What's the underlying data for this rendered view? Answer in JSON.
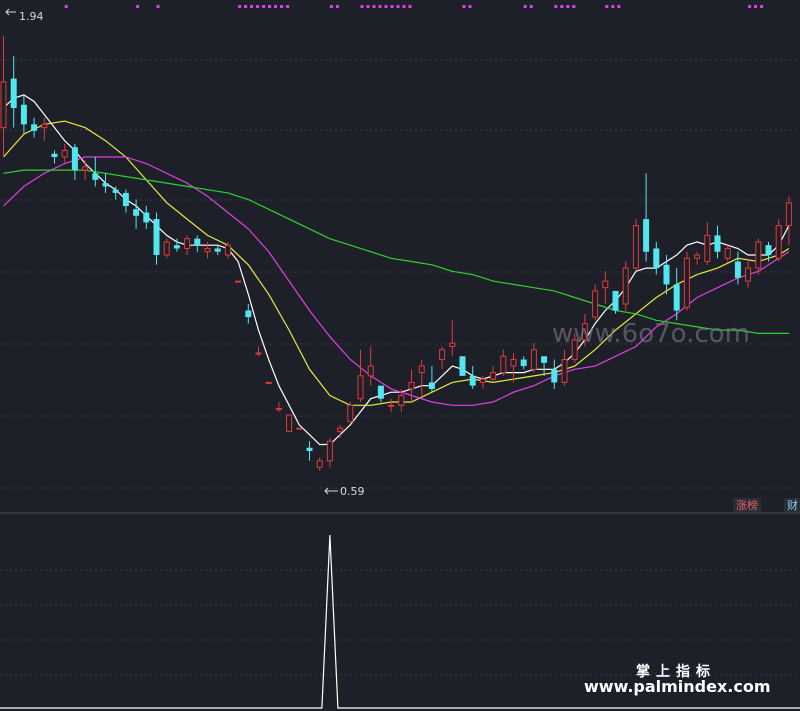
{
  "chart_data": {
    "type": "candlestick",
    "price_range": [
      0.5,
      2.0
    ],
    "high_label": "1.94",
    "low_label": "0.59",
    "tags": {
      "limit_up": "涨榜",
      "finance": "财"
    },
    "colors": {
      "background": "#1e2029",
      "up": "#e03a3a",
      "down": "#52e6f0",
      "ma_white": "#ffffff",
      "ma_yellow": "#e8e840",
      "ma_magenta": "#e040e0",
      "ma_green": "#30d030",
      "marker": "#e040e0"
    },
    "candles": [
      [
        1.64,
        1.92,
        1.55,
        1.78
      ],
      [
        1.79,
        1.86,
        1.64,
        1.7
      ],
      [
        1.71,
        1.74,
        1.62,
        1.65
      ],
      [
        1.65,
        1.67,
        1.61,
        1.63
      ],
      [
        1.64,
        1.67,
        1.6,
        1.65
      ],
      [
        1.56,
        1.57,
        1.53,
        1.55
      ],
      [
        1.55,
        1.59,
        1.53,
        1.57
      ],
      [
        1.58,
        1.59,
        1.48,
        1.51
      ],
      [
        1.51,
        1.54,
        1.48,
        1.52
      ],
      [
        1.5,
        1.55,
        1.46,
        1.48
      ],
      [
        1.47,
        1.5,
        1.44,
        1.46
      ],
      [
        1.45,
        1.46,
        1.42,
        1.44
      ],
      [
        1.44,
        1.45,
        1.38,
        1.4
      ],
      [
        1.39,
        1.42,
        1.33,
        1.37
      ],
      [
        1.38,
        1.4,
        1.33,
        1.35
      ],
      [
        1.36,
        1.38,
        1.22,
        1.25
      ],
      [
        1.25,
        1.3,
        1.24,
        1.29
      ],
      [
        1.28,
        1.3,
        1.26,
        1.27
      ],
      [
        1.27,
        1.31,
        1.25,
        1.3
      ],
      [
        1.3,
        1.31,
        1.26,
        1.28
      ],
      [
        1.26,
        1.29,
        1.24,
        1.27
      ],
      [
        1.27,
        1.28,
        1.25,
        1.26
      ],
      [
        1.25,
        1.29,
        1.24,
        1.28
      ],
      [
        1.17,
        1.17,
        1.17,
        1.17
      ],
      [
        1.08,
        1.1,
        1.04,
        1.06
      ],
      [
        0.95,
        0.97,
        0.94,
        0.95
      ],
      [
        0.86,
        0.86,
        0.86,
        0.86
      ],
      [
        0.78,
        0.8,
        0.77,
        0.78
      ],
      [
        0.71,
        0.76,
        0.71,
        0.76
      ],
      [
        0.72,
        0.72,
        0.72,
        0.72
      ],
      [
        0.66,
        0.68,
        0.62,
        0.65
      ],
      [
        0.6,
        0.63,
        0.59,
        0.62
      ],
      [
        0.62,
        0.69,
        0.6,
        0.68
      ],
      [
        0.71,
        0.73,
        0.69,
        0.72
      ],
      [
        0.74,
        0.8,
        0.74,
        0.79
      ],
      [
        0.81,
        0.96,
        0.8,
        0.88
      ],
      [
        0.88,
        0.97,
        0.85,
        0.91
      ],
      [
        0.85,
        0.85,
        0.8,
        0.81
      ],
      [
        0.79,
        0.81,
        0.77,
        0.79
      ],
      [
        0.79,
        0.84,
        0.77,
        0.82
      ],
      [
        0.84,
        0.9,
        0.8,
        0.86
      ],
      [
        0.89,
        0.93,
        0.82,
        0.91
      ],
      [
        0.86,
        0.91,
        0.83,
        0.84
      ],
      [
        0.93,
        0.97,
        0.9,
        0.96
      ],
      [
        0.97,
        1.05,
        0.94,
        0.98
      ],
      [
        0.94,
        0.94,
        0.88,
        0.88
      ],
      [
        0.88,
        0.91,
        0.84,
        0.85
      ],
      [
        0.86,
        0.88,
        0.84,
        0.87
      ],
      [
        0.87,
        0.91,
        0.86,
        0.89
      ],
      [
        0.89,
        0.96,
        0.88,
        0.94
      ],
      [
        0.91,
        0.95,
        0.86,
        0.93
      ],
      [
        0.93,
        0.94,
        0.9,
        0.91
      ],
      [
        0.9,
        0.98,
        0.89,
        0.96
      ],
      [
        0.94,
        0.94,
        0.88,
        0.92
      ],
      [
        0.9,
        0.93,
        0.84,
        0.86
      ],
      [
        0.86,
        0.96,
        0.85,
        0.93
      ],
      [
        0.93,
        1.01,
        0.92,
        0.99
      ],
      [
        0.99,
        1.07,
        0.97,
        1.04
      ],
      [
        1.06,
        1.16,
        1.05,
        1.14
      ],
      [
        1.15,
        1.2,
        1.1,
        1.17
      ],
      [
        1.14,
        1.14,
        1.07,
        1.08
      ],
      [
        1.1,
        1.23,
        1.08,
        1.21
      ],
      [
        1.21,
        1.36,
        1.2,
        1.34
      ],
      [
        1.36,
        1.5,
        1.23,
        1.26
      ],
      [
        1.27,
        1.29,
        1.19,
        1.21
      ],
      [
        1.22,
        1.25,
        1.13,
        1.16
      ],
      [
        1.16,
        1.21,
        1.05,
        1.08
      ],
      [
        1.09,
        1.26,
        1.08,
        1.24
      ],
      [
        1.24,
        1.26,
        1.22,
        1.25
      ],
      [
        1.23,
        1.35,
        1.22,
        1.31
      ],
      [
        1.31,
        1.34,
        1.24,
        1.26
      ],
      [
        1.24,
        1.28,
        1.23,
        1.27
      ],
      [
        1.23,
        1.26,
        1.16,
        1.18
      ],
      [
        1.17,
        1.24,
        1.15,
        1.21
      ],
      [
        1.21,
        1.3,
        1.19,
        1.29
      ],
      [
        1.28,
        1.29,
        1.23,
        1.25
      ],
      [
        1.24,
        1.36,
        1.23,
        1.34
      ],
      [
        1.34,
        1.43,
        1.28,
        1.41
      ]
    ],
    "moving_averages": [
      {
        "color": "#ffffff",
        "points": [
          [
            0,
            1.7
          ],
          [
            1,
            1.73
          ],
          [
            2,
            1.74
          ],
          [
            3,
            1.72
          ],
          [
            4,
            1.68
          ],
          [
            5,
            1.64
          ],
          [
            6,
            1.6
          ],
          [
            7,
            1.57
          ],
          [
            8,
            1.53
          ],
          [
            9,
            1.5
          ],
          [
            10,
            1.47
          ],
          [
            11,
            1.45
          ],
          [
            12,
            1.42
          ],
          [
            13,
            1.4
          ],
          [
            14,
            1.37
          ],
          [
            15,
            1.34
          ],
          [
            16,
            1.31
          ],
          [
            17,
            1.29
          ],
          [
            18,
            1.28
          ],
          [
            19,
            1.28
          ],
          [
            20,
            1.28
          ],
          [
            21,
            1.28
          ],
          [
            22,
            1.27
          ],
          [
            23,
            1.23
          ],
          [
            24,
            1.13
          ],
          [
            25,
            1.02
          ],
          [
            26,
            0.93
          ],
          [
            27,
            0.85
          ],
          [
            28,
            0.79
          ],
          [
            29,
            0.73
          ],
          [
            30,
            0.7
          ],
          [
            31,
            0.67
          ],
          [
            32,
            0.67
          ],
          [
            33,
            0.7
          ],
          [
            34,
            0.73
          ],
          [
            35,
            0.77
          ],
          [
            36,
            0.81
          ],
          [
            37,
            0.82
          ],
          [
            38,
            0.83
          ],
          [
            39,
            0.83
          ],
          [
            40,
            0.84
          ],
          [
            41,
            0.85
          ],
          [
            42,
            0.85
          ],
          [
            43,
            0.88
          ],
          [
            44,
            0.91
          ],
          [
            45,
            0.9
          ],
          [
            46,
            0.88
          ],
          [
            47,
            0.87
          ],
          [
            48,
            0.88
          ],
          [
            49,
            0.89
          ],
          [
            50,
            0.89
          ],
          [
            51,
            0.89
          ],
          [
            52,
            0.9
          ],
          [
            53,
            0.9
          ],
          [
            54,
            0.9
          ],
          [
            55,
            0.92
          ],
          [
            56,
            0.95
          ],
          [
            57,
            0.99
          ],
          [
            58,
            1.04
          ],
          [
            59,
            1.08
          ],
          [
            60,
            1.11
          ],
          [
            61,
            1.15
          ],
          [
            62,
            1.2
          ],
          [
            63,
            1.21
          ],
          [
            64,
            1.21
          ],
          [
            65,
            1.23
          ],
          [
            66,
            1.25
          ],
          [
            67,
            1.28
          ],
          [
            68,
            1.29
          ],
          [
            69,
            1.28
          ],
          [
            70,
            1.29
          ],
          [
            71,
            1.28
          ],
          [
            72,
            1.27
          ],
          [
            73,
            1.25
          ],
          [
            74,
            1.25
          ],
          [
            75,
            1.25
          ],
          [
            76,
            1.28
          ],
          [
            77,
            1.34
          ]
        ]
      },
      {
        "color": "#e8e840",
        "points": [
          [
            0,
            1.55
          ],
          [
            2,
            1.62
          ],
          [
            4,
            1.65
          ],
          [
            6,
            1.66
          ],
          [
            8,
            1.64
          ],
          [
            10,
            1.6
          ],
          [
            12,
            1.55
          ],
          [
            14,
            1.48
          ],
          [
            16,
            1.41
          ],
          [
            18,
            1.36
          ],
          [
            20,
            1.31
          ],
          [
            22,
            1.28
          ],
          [
            24,
            1.22
          ],
          [
            26,
            1.13
          ],
          [
            28,
            1.02
          ],
          [
            30,
            0.9
          ],
          [
            32,
            0.82
          ],
          [
            34,
            0.79
          ],
          [
            36,
            0.79
          ],
          [
            38,
            0.8
          ],
          [
            40,
            0.8
          ],
          [
            42,
            0.83
          ],
          [
            44,
            0.86
          ],
          [
            46,
            0.87
          ],
          [
            48,
            0.86
          ],
          [
            50,
            0.87
          ],
          [
            52,
            0.88
          ],
          [
            54,
            0.89
          ],
          [
            56,
            0.91
          ],
          [
            58,
            0.96
          ],
          [
            60,
            1.02
          ],
          [
            62,
            1.07
          ],
          [
            64,
            1.12
          ],
          [
            66,
            1.16
          ],
          [
            68,
            1.19
          ],
          [
            70,
            1.21
          ],
          [
            72,
            1.24
          ],
          [
            74,
            1.23
          ],
          [
            76,
            1.25
          ],
          [
            77,
            1.27
          ]
        ]
      },
      {
        "color": "#e040e0",
        "points": [
          [
            0,
            1.4
          ],
          [
            2,
            1.46
          ],
          [
            4,
            1.5
          ],
          [
            6,
            1.53
          ],
          [
            8,
            1.55
          ],
          [
            10,
            1.55
          ],
          [
            12,
            1.55
          ],
          [
            14,
            1.53
          ],
          [
            16,
            1.5
          ],
          [
            18,
            1.47
          ],
          [
            20,
            1.43
          ],
          [
            22,
            1.38
          ],
          [
            24,
            1.33
          ],
          [
            26,
            1.26
          ],
          [
            28,
            1.17
          ],
          [
            30,
            1.08
          ],
          [
            32,
            1.0
          ],
          [
            34,
            0.93
          ],
          [
            36,
            0.88
          ],
          [
            38,
            0.84
          ],
          [
            40,
            0.82
          ],
          [
            42,
            0.8
          ],
          [
            44,
            0.79
          ],
          [
            46,
            0.79
          ],
          [
            48,
            0.8
          ],
          [
            50,
            0.83
          ],
          [
            52,
            0.85
          ],
          [
            54,
            0.88
          ],
          [
            56,
            0.9
          ],
          [
            58,
            0.91
          ],
          [
            60,
            0.94
          ],
          [
            62,
            0.97
          ],
          [
            64,
            1.03
          ],
          [
            66,
            1.07
          ],
          [
            68,
            1.12
          ],
          [
            70,
            1.15
          ],
          [
            72,
            1.18
          ],
          [
            74,
            1.2
          ],
          [
            76,
            1.24
          ],
          [
            77,
            1.26
          ]
        ]
      },
      {
        "color": "#30d030",
        "points": [
          [
            0,
            1.5
          ],
          [
            2,
            1.51
          ],
          [
            4,
            1.51
          ],
          [
            6,
            1.51
          ],
          [
            8,
            1.51
          ],
          [
            10,
            1.5
          ],
          [
            12,
            1.49
          ],
          [
            14,
            1.48
          ],
          [
            16,
            1.47
          ],
          [
            18,
            1.46
          ],
          [
            20,
            1.45
          ],
          [
            22,
            1.44
          ],
          [
            24,
            1.42
          ],
          [
            26,
            1.39
          ],
          [
            28,
            1.36
          ],
          [
            30,
            1.33
          ],
          [
            32,
            1.3
          ],
          [
            34,
            1.28
          ],
          [
            36,
            1.26
          ],
          [
            38,
            1.24
          ],
          [
            40,
            1.23
          ],
          [
            42,
            1.22
          ],
          [
            44,
            1.2
          ],
          [
            46,
            1.19
          ],
          [
            48,
            1.17
          ],
          [
            50,
            1.16
          ],
          [
            52,
            1.15
          ],
          [
            54,
            1.14
          ],
          [
            56,
            1.12
          ],
          [
            58,
            1.1
          ],
          [
            60,
            1.08
          ],
          [
            62,
            1.07
          ],
          [
            64,
            1.05
          ],
          [
            66,
            1.04
          ],
          [
            68,
            1.03
          ],
          [
            70,
            1.02
          ],
          [
            72,
            1.02
          ],
          [
            74,
            1.01
          ],
          [
            76,
            1.01
          ],
          [
            77,
            1.01
          ]
        ]
      }
    ],
    "top_markers": [
      {
        "start": 6,
        "count": 1
      },
      {
        "start": 13,
        "count": 1
      },
      {
        "start": 15,
        "count": 1
      },
      {
        "start": 23,
        "count": 9
      },
      {
        "start": 32,
        "count": 2
      },
      {
        "start": 35,
        "count": 9
      },
      {
        "start": 45,
        "count": 2
      },
      {
        "start": 51,
        "count": 2
      },
      {
        "start": 54,
        "count": 4
      },
      {
        "start": 59,
        "count": 3
      },
      {
        "start": 73,
        "count": 3
      }
    ],
    "indicator": {
      "values_by_index": {
        "32": 1
      }
    }
  },
  "watermarks": {
    "top_text": "www.6o7o.com",
    "cn_text": "掌上指标",
    "site_text": "www.palmindex.com"
  }
}
